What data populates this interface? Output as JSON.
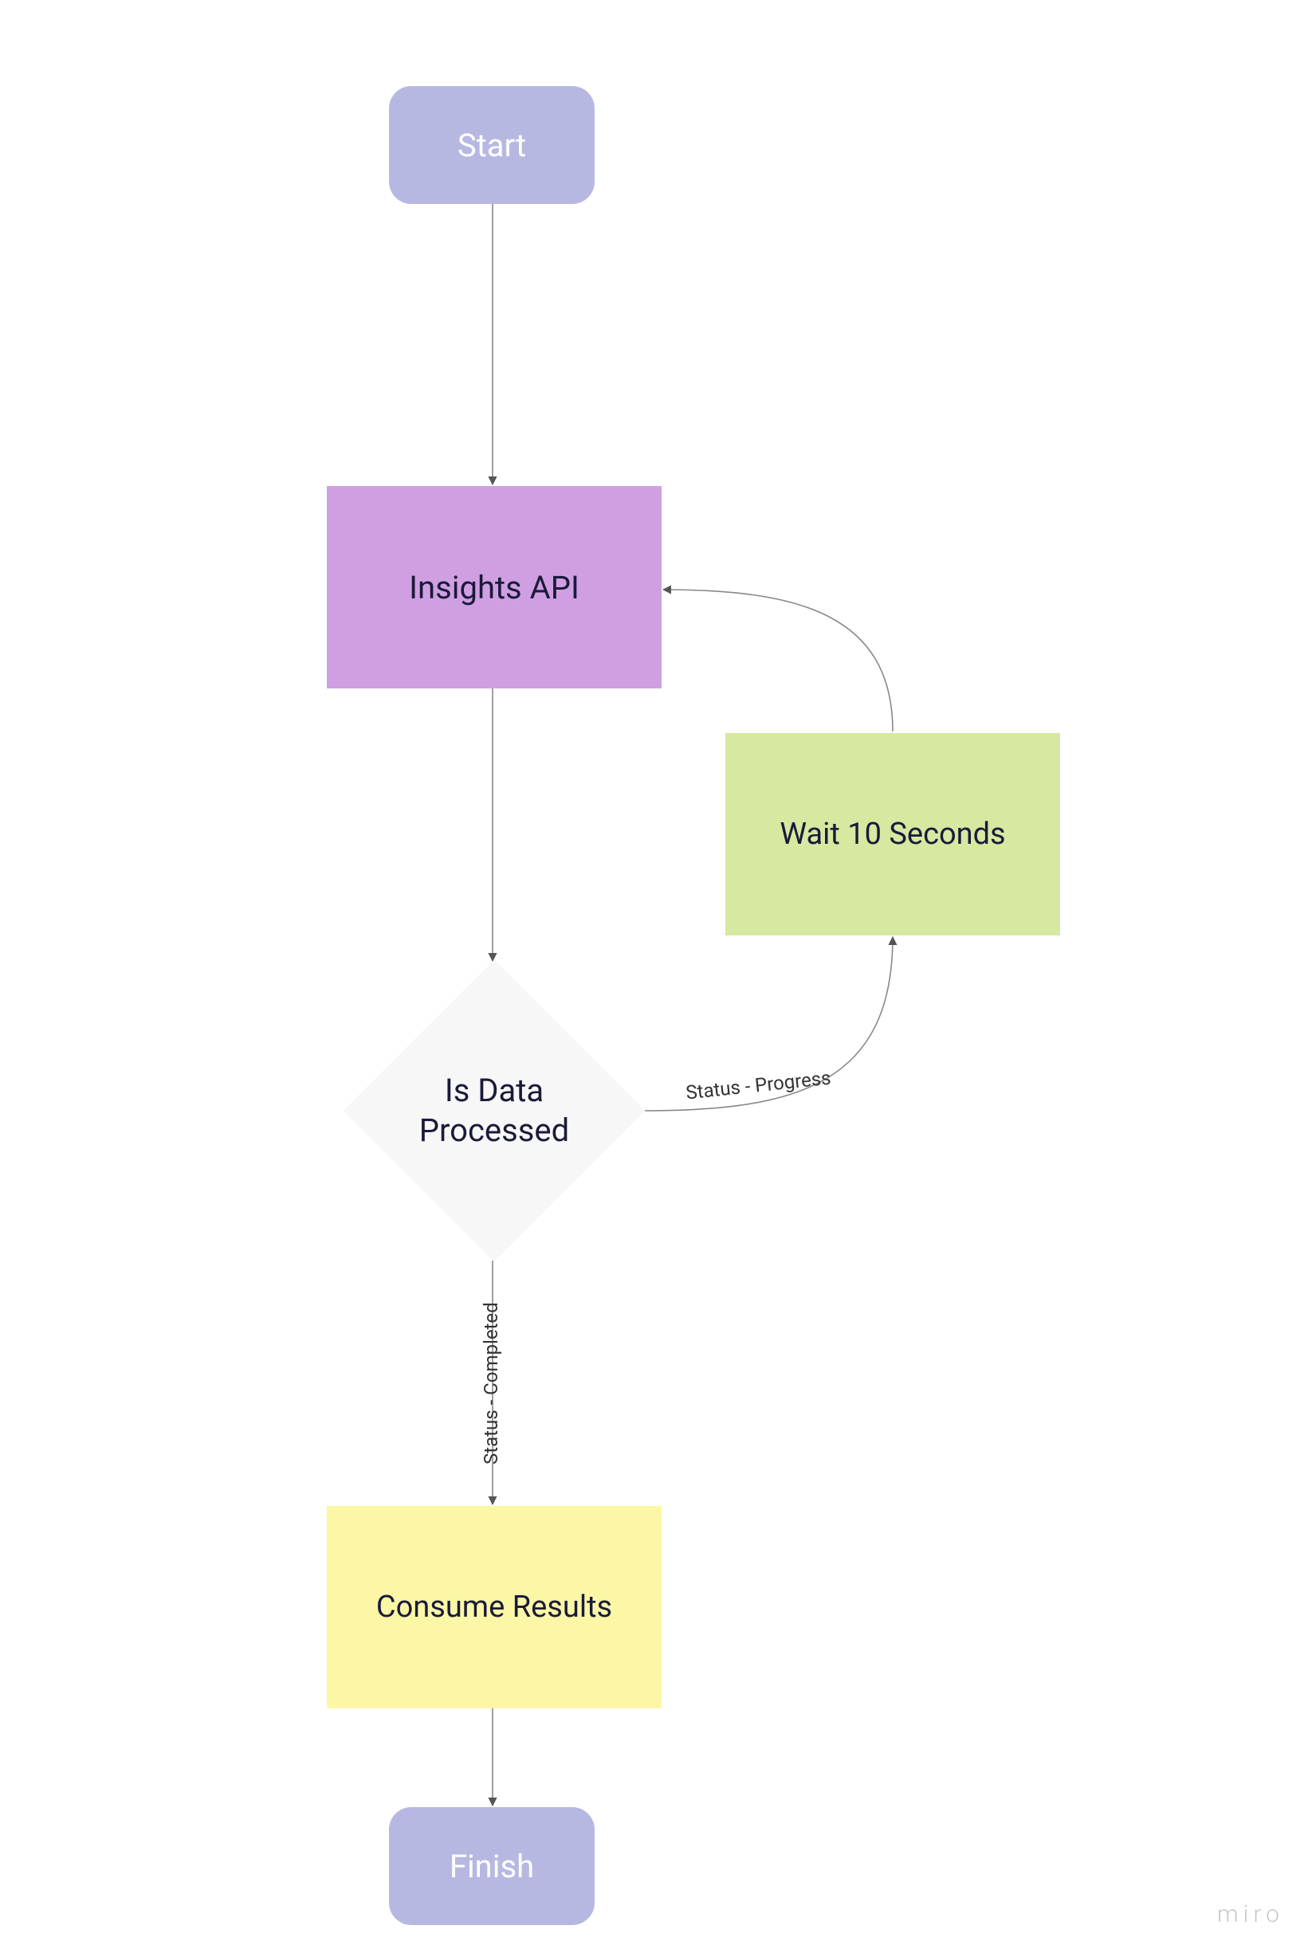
{
  "nodes": {
    "start": "Start",
    "insights": "Insights API",
    "wait": "Wait 10 Seconds",
    "decision": "Is Data Processed",
    "consume": "Consume Results",
    "finish": "Finish"
  },
  "edges": {
    "progress": "Status - Progress",
    "completed": "Status - Completed"
  },
  "watermark": "miro"
}
